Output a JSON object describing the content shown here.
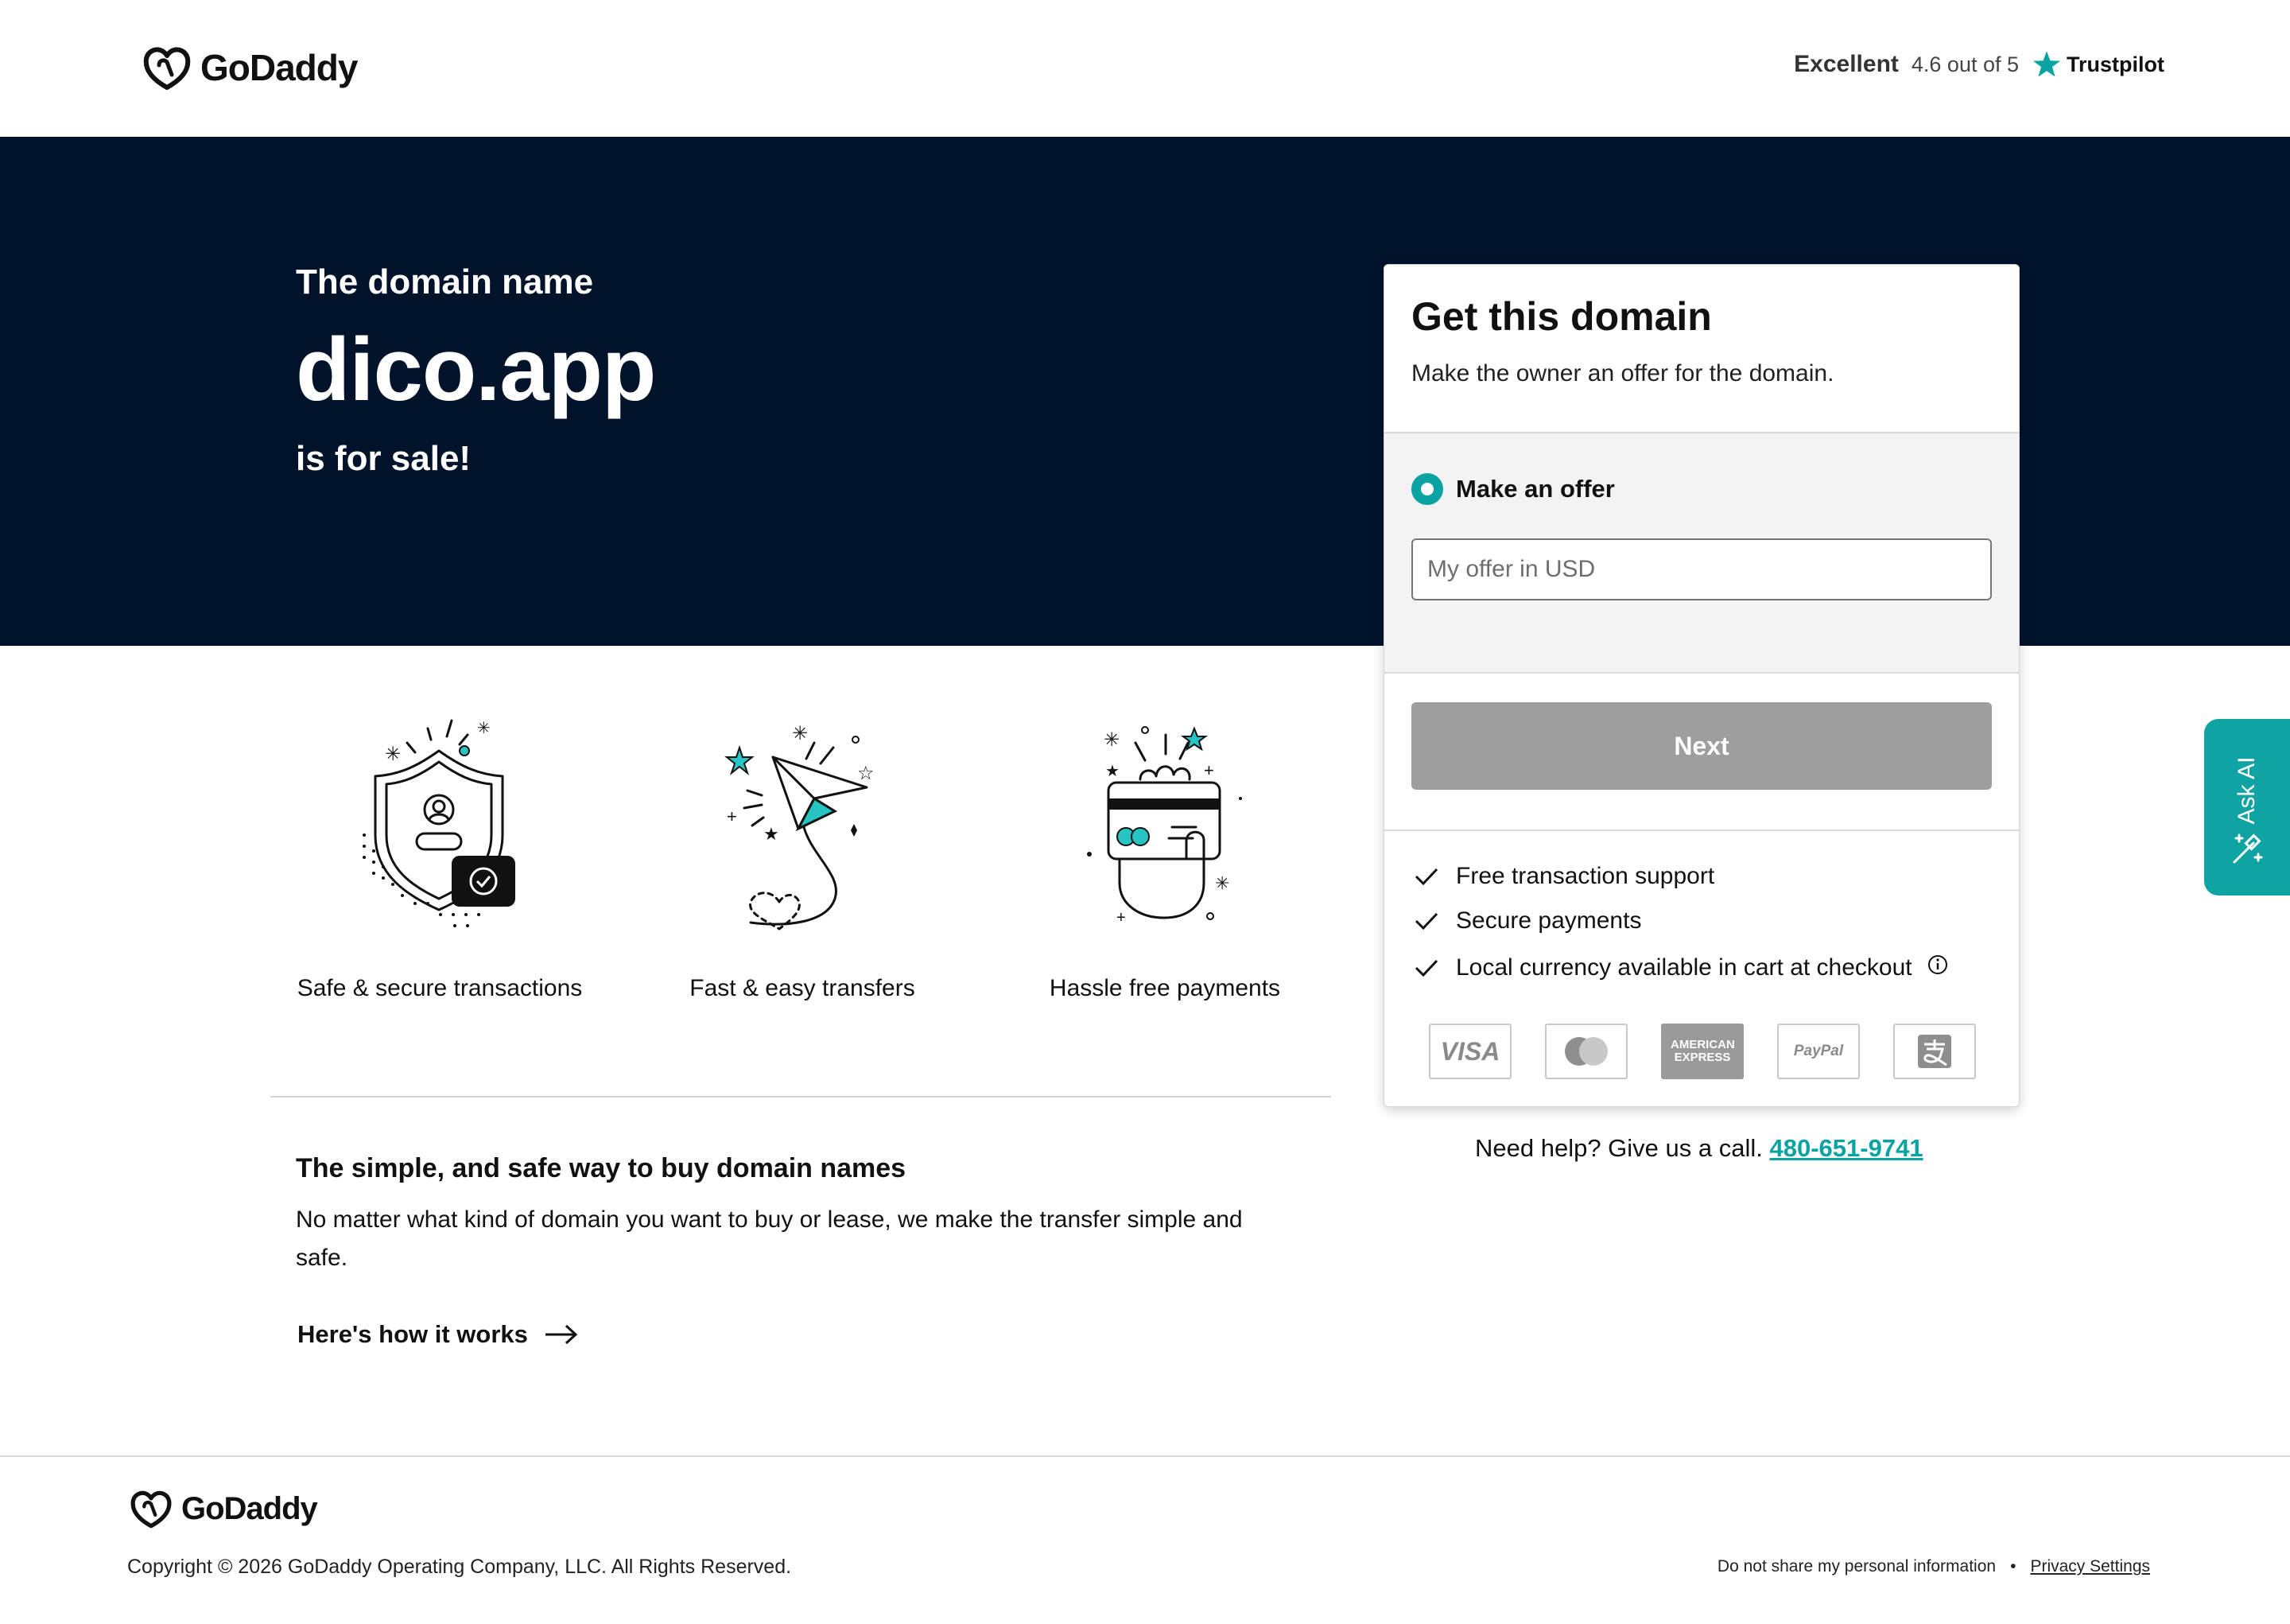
{
  "header": {
    "logo_text": "GoDaddy",
    "trustpilot": {
      "rating_word": "Excellent",
      "score_text": "4.6 out of 5",
      "brand": "Trustpilot"
    }
  },
  "hero": {
    "pre_text": "The domain name",
    "domain": "dico.app",
    "post_text": "is for sale!"
  },
  "offer_card": {
    "title": "Get this domain",
    "subtitle": "Make the owner an offer for the domain.",
    "option_label": "Make an offer",
    "offer_input": {
      "value": "",
      "placeholder": "My offer in USD"
    },
    "next_label": "Next",
    "features": [
      "Free transaction support",
      "Secure payments",
      "Local currency available in cart at checkout"
    ],
    "payment_methods": [
      "VISA",
      "mastercard",
      "AMERICAN EXPRESS",
      "PayPal",
      "alipay"
    ]
  },
  "help": {
    "text": "Need help? Give us a call.",
    "phone": "480-651-9741"
  },
  "features_row": [
    {
      "label": "Safe & secure transactions",
      "icon": "shield-icon"
    },
    {
      "label": "Fast & easy transfers",
      "icon": "paper-plane-icon"
    },
    {
      "label": "Hassle free payments",
      "icon": "card-hand-icon"
    }
  ],
  "info": {
    "title": "The simple, and safe way to buy domain names",
    "body": "No matter what kind of domain you want to buy or lease, we make the transfer simple and safe.",
    "link_label": "Here's how it works"
  },
  "ask_ai": {
    "label": "Ask AI"
  },
  "footer": {
    "logo_text": "GoDaddy",
    "copyright": "Copyright © 2026 GoDaddy Operating Company, LLC. All Rights Reserved.",
    "do_not_share": "Do not share my personal information",
    "privacy": "Privacy Settings"
  },
  "colors": {
    "hero_bg": "#00132b",
    "accent": "#09a3a3",
    "button_disabled": "#9e9e9e",
    "trustpilot_star": "#00b67a"
  }
}
